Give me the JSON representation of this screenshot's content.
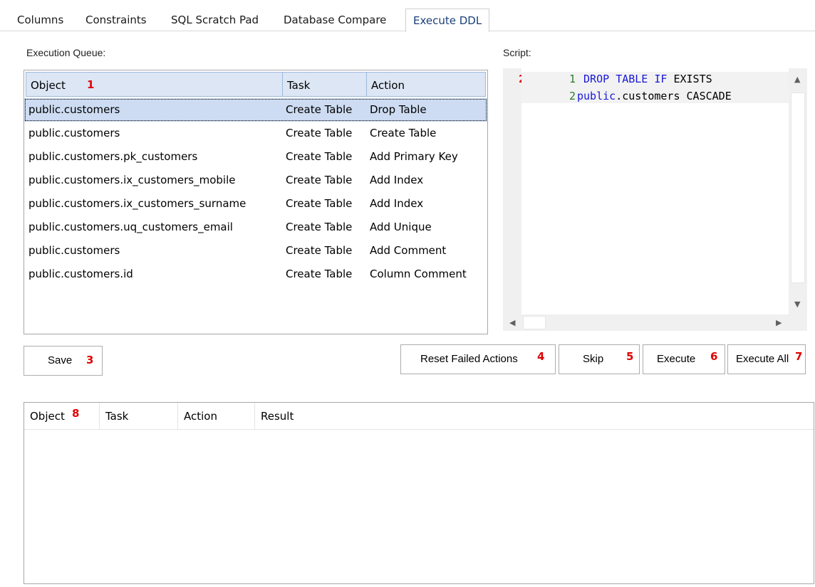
{
  "tabs": [
    "Columns",
    "Constraints",
    "SQL Scratch Pad",
    "Database Compare",
    "Execute DDL"
  ],
  "active_tab": "Execute DDL",
  "queue": {
    "label": "Execution Queue:",
    "marker": "1",
    "columns": [
      "Object",
      "Task",
      "Action"
    ],
    "rows": [
      {
        "object": "public.customers",
        "task": "Create Table",
        "action": "Drop Table"
      },
      {
        "object": "public.customers",
        "task": "Create Table",
        "action": "Create Table"
      },
      {
        "object": "public.customers.pk_customers",
        "task": "Create Table",
        "action": "Add Primary Key"
      },
      {
        "object": "public.customers.ix_customers_mobile",
        "task": "Create Table",
        "action": "Add Index"
      },
      {
        "object": "public.customers.ix_customers_surname",
        "task": "Create Table",
        "action": "Add Index"
      },
      {
        "object": "public.customers.uq_customers_email",
        "task": "Create Table",
        "action": "Add Unique"
      },
      {
        "object": "public.customers",
        "task": "Create Table",
        "action": "Add Comment"
      },
      {
        "object": "public.customers.id",
        "task": "Create Table",
        "action": "Column Comment"
      }
    ]
  },
  "script": {
    "label": "Script:",
    "marker": "2",
    "lines": [
      {
        "no": "1",
        "kw1": "DROP",
        "kw2": "TABLE",
        "kw3": "IF",
        "rest": "EXISTS"
      },
      {
        "no": "2",
        "schema": "public",
        "rest": ".customers CASCADE"
      }
    ]
  },
  "buttons": {
    "save": {
      "label": "Save",
      "marker": "3"
    },
    "reset": {
      "label": "Reset Failed Actions",
      "marker": "4"
    },
    "skip": {
      "label": "Skip",
      "marker": "5"
    },
    "execute": {
      "label": "Execute",
      "marker": "6"
    },
    "execute_all": {
      "label": "Execute All",
      "marker": "7"
    }
  },
  "results": {
    "marker": "8",
    "columns": [
      "Object",
      "Task",
      "Action",
      "Result"
    ]
  },
  "colors": {
    "selection": "#cddcf2",
    "header": "#dce6f4",
    "marker": "#e00000",
    "keyword": "#1818d8",
    "line_number": "#2b7a2b"
  }
}
